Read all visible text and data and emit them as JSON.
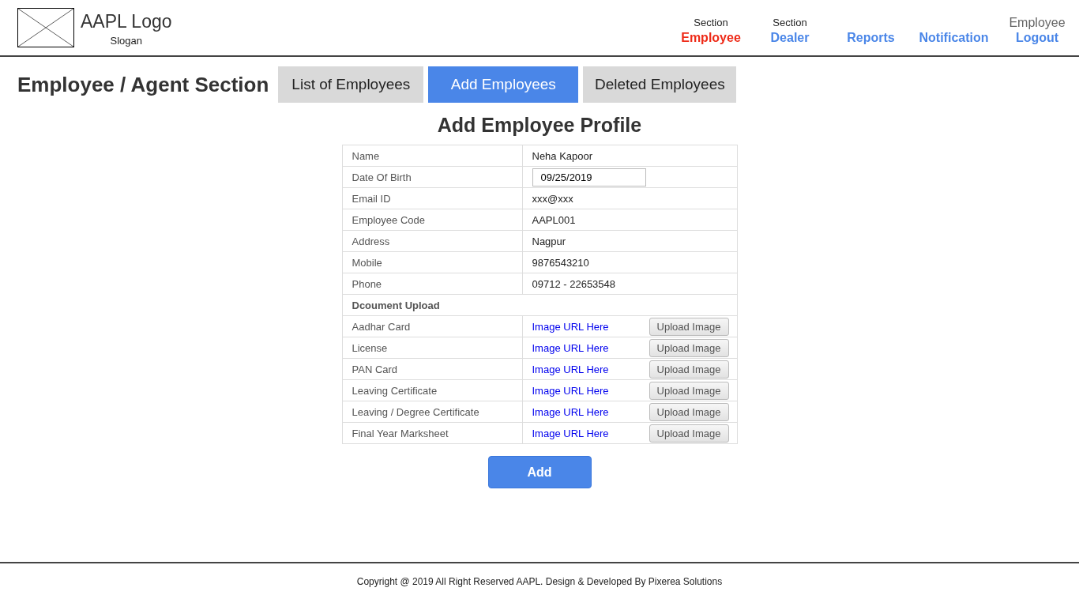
{
  "header": {
    "logo_title": "AAPL Logo",
    "slogan": "Slogan",
    "nav": [
      {
        "kind": "section",
        "caption": "Section",
        "label": "Employee",
        "selected": true
      },
      {
        "kind": "section",
        "caption": "Section",
        "label": "Dealer",
        "selected": false
      },
      {
        "kind": "plain",
        "label": "Reports",
        "selected": false
      },
      {
        "kind": "plain",
        "label": "Notification",
        "selected": false
      },
      {
        "kind": "account",
        "caption": "Employee",
        "label": "Logout",
        "selected": false
      }
    ]
  },
  "page_title": "Employee / Agent Section",
  "tabs": [
    {
      "label": "List of Employees",
      "selected": false
    },
    {
      "label": "Add Employees",
      "selected": true
    },
    {
      "label": "Deleted Employees",
      "selected": false
    }
  ],
  "form": {
    "title": "Add Employee Profile",
    "fields": [
      {
        "kind": "text",
        "label": "Name",
        "value": "Neha Kapoor"
      },
      {
        "kind": "input",
        "label": "Date Of Birth",
        "value": "09/25/2019"
      },
      {
        "kind": "text",
        "label": "Email ID",
        "value": "xxx@xxx"
      },
      {
        "kind": "text",
        "label": "Employee Code",
        "value": "AAPL001"
      },
      {
        "kind": "text",
        "label": "Address",
        "value": "Nagpur"
      },
      {
        "kind": "text",
        "label": "Mobile",
        "value": "9876543210"
      },
      {
        "kind": "text",
        "label": "Phone",
        "value": "09712 - 22653548"
      }
    ],
    "documents_heading": "Dcoument Upload",
    "documents": [
      {
        "label": "Aadhar Card",
        "url": "Image URL Here",
        "button": "Upload Image"
      },
      {
        "label": "License",
        "url": "Image URL Here",
        "button": "Upload Image"
      },
      {
        "label": "PAN Card",
        "url": "Image URL Here",
        "button": "Upload Image"
      },
      {
        "label": "Leaving Certificate",
        "url": "Image URL Here",
        "button": "Upload Image"
      },
      {
        "label": "Leaving / Degree Certificate",
        "url": "Image URL Here",
        "button": "Upload Image"
      },
      {
        "label": "Final Year Marksheet",
        "url": "Image URL Here",
        "button": "Upload Image"
      }
    ],
    "submit": "Add"
  },
  "footer": "Copyright @ 2019 All Right Reserved AAPL. Design & Developed By Pixerea Solutions"
}
